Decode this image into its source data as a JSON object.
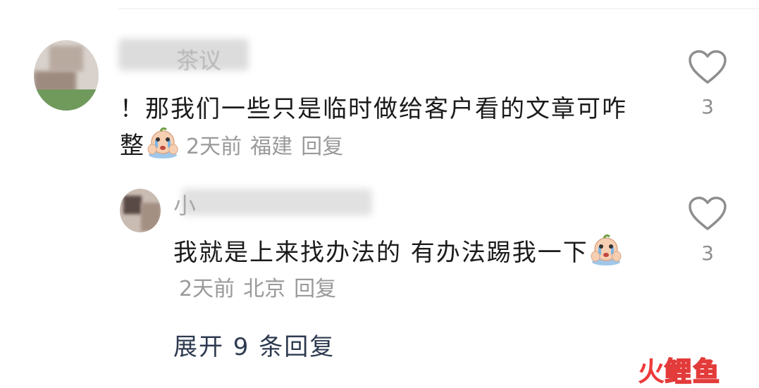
{
  "comments": [
    {
      "author": "茶议",
      "text": "！那我们一些只是临时做给客户看的文章可咋整",
      "emoji": "crying-face-emoji",
      "time": "2天前",
      "location": "福建",
      "reply_label": "回复",
      "likes": "3",
      "replies": [
        {
          "author": "小",
          "text": "我就是上来找办法的 有办法踢我一下",
          "emoji": "crying-face-emoji",
          "time": "2天前",
          "location": "北京",
          "reply_label": "回复",
          "likes": "3"
        }
      ],
      "expand_label": "展开 9 条回复"
    }
  ],
  "watermark": {
    "char1": "火",
    "rest": "鲤鱼",
    "color": "#ee3a3a"
  },
  "colors": {
    "text": "#1b1b1b",
    "meta": "#9a9a9a",
    "expand": "#2e3a50",
    "heart": "#8e8e8e"
  }
}
